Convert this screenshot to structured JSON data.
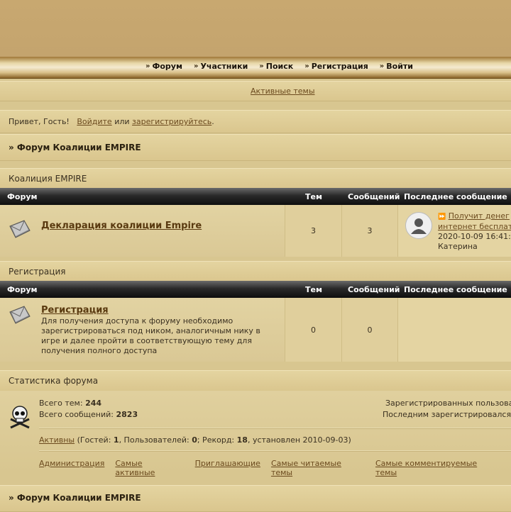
{
  "nav": {
    "items": [
      "Форум",
      "Участники",
      "Поиск",
      "Регистрация",
      "Войти"
    ]
  },
  "active_topics": "Активные темы",
  "greeting": {
    "prefix": "Привет, Гость!",
    "login": "Войдите",
    "or": "или",
    "register": "зарегистрируйтесь",
    "suffix": "."
  },
  "breadcrumb": "» Форум Коалиции EMPIRE",
  "categories": [
    {
      "name": "Коалиция EMPIRE",
      "headers": {
        "forum": "Форум",
        "topics": "Тем",
        "posts": "Сообщений",
        "last": "Последнее сообщение"
      },
      "forum": {
        "title": "Декларация коалиции Empire",
        "description": "",
        "topics": "3",
        "posts": "3",
        "last_title": "Получит денег",
        "last_title_2": "интернет бесплат",
        "last_date": "2020-10-09 16:41:",
        "last_author": "Катерина"
      }
    },
    {
      "name": "Регистрация",
      "headers": {
        "forum": "Форум",
        "topics": "Тем",
        "posts": "Сообщений",
        "last": "Последнее сообщение"
      },
      "forum": {
        "title": "Регистрация",
        "description": "Для получения доступа к форуму необходимо зарегистрироваться под ником, аналогичным нику в игре и далее пройти в соответствующую тему для получения полного доступа",
        "topics": "0",
        "posts": "0"
      }
    }
  ],
  "stats": {
    "title": "Статистика форума",
    "topics_label": "Всего тем:",
    "topics_value": "244",
    "posts_label": "Всего сообщений:",
    "posts_value": "2823",
    "registered_label": "Зарегистрированных пользова",
    "last_registered_label": "Последним зарегистрировался",
    "online_link": "Активны",
    "online_text_1": " (Гостей: ",
    "guests": "1",
    "online_text_2": ", Пользователей: ",
    "users": "0",
    "online_text_3": "; Рекорд: ",
    "record": "18",
    "online_text_4": ", установлен 2010-09-03)",
    "links": [
      "Администрация",
      "Самые активные",
      "Приглашающие",
      "Самые читаемые темы",
      "Самые комментируемые темы"
    ]
  },
  "breadcrumb_bottom": "» Форум Коалиции EMPIRE"
}
